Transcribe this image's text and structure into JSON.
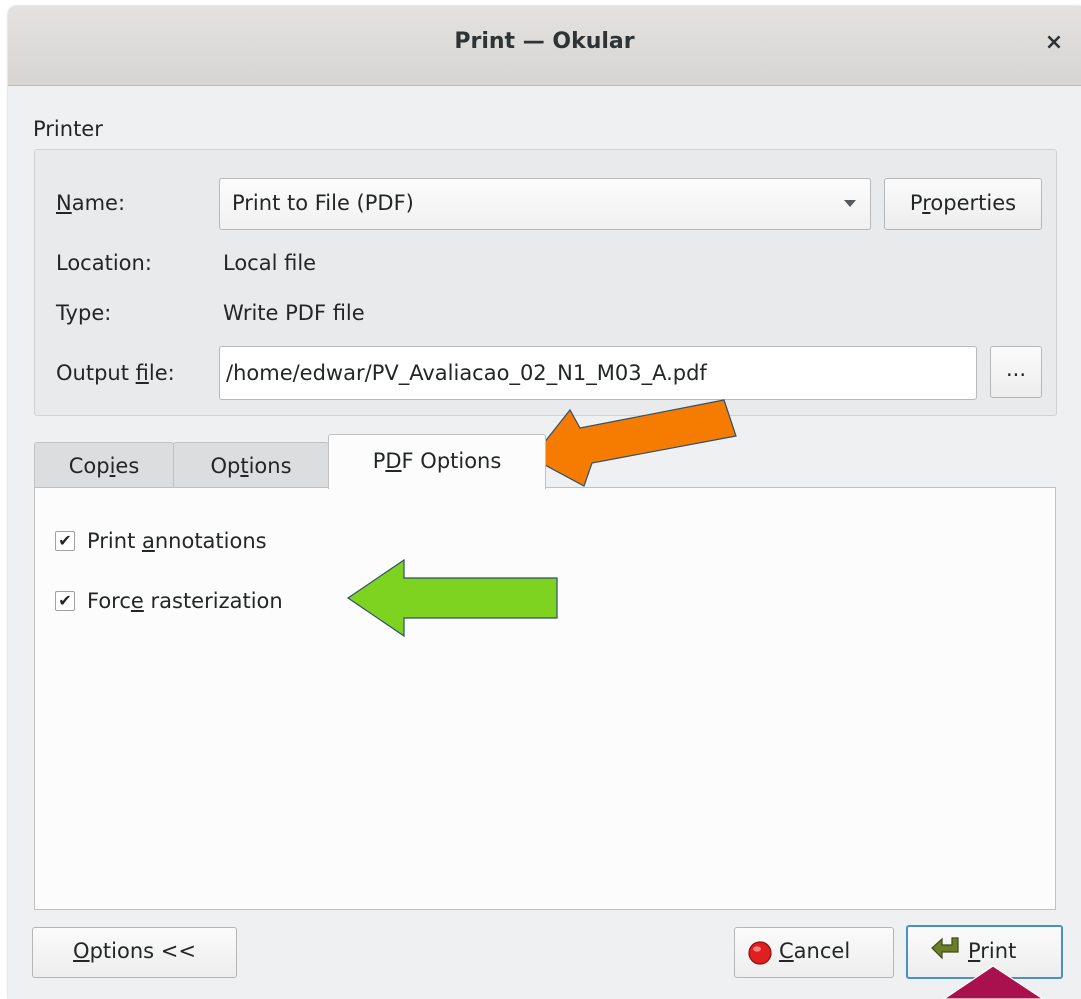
{
  "window": {
    "title": "Print — Okular",
    "close_glyph": "×"
  },
  "printer": {
    "section_label": "Printer",
    "name_label": {
      "pre": "",
      "mn": "N",
      "post": "ame:"
    },
    "name_value": "Print to File (PDF)",
    "properties_button": {
      "pre": "P",
      "mn": "r",
      "post": "operties"
    },
    "location_label": "Location:",
    "location_value": "Local file",
    "type_label": "Type:",
    "type_value": "Write PDF file",
    "output_label": {
      "pre": "Output ",
      "mn": "f",
      "post": "ile:"
    },
    "output_value": "/home/edwar/PV_Avaliacao_02_N1_M03_A.pdf",
    "browse_button": "..."
  },
  "tabs": [
    {
      "pre": "Cop",
      "mn": "i",
      "post": "es"
    },
    {
      "pre": "Op",
      "mn": "t",
      "post": "ions"
    },
    {
      "pre": "P",
      "mn": "D",
      "post": "F Options"
    }
  ],
  "pdf_options": {
    "print_annotations": {
      "pre": "Print ",
      "mn": "a",
      "post": "nnotations",
      "checked": true
    },
    "force_rasterization": {
      "pre": "Forc",
      "mn": "e",
      "post": " rasterization",
      "checked": true
    },
    "check_glyph": "✔"
  },
  "footer": {
    "options_button": {
      "pre": "",
      "mn": "O",
      "post": "ptions <<"
    },
    "cancel_button": {
      "pre": "",
      "mn": "C",
      "post": "ancel"
    },
    "print_button": {
      "pre": "",
      "mn": "P",
      "post": "rint"
    }
  },
  "colors": {
    "annotation_orange": "#f57c00",
    "annotation_green": "#7ed321",
    "annotation_magenta": "#a8104e",
    "cancel_icon_red": "#e02020",
    "print_icon_olive": "#6b7f2a",
    "print_button_border": "#4a90c2"
  },
  "icons": {
    "cancel": "stop-icon",
    "print": "print-arrow-icon",
    "dropdown": "chevron-down-icon",
    "close": "close-icon"
  }
}
